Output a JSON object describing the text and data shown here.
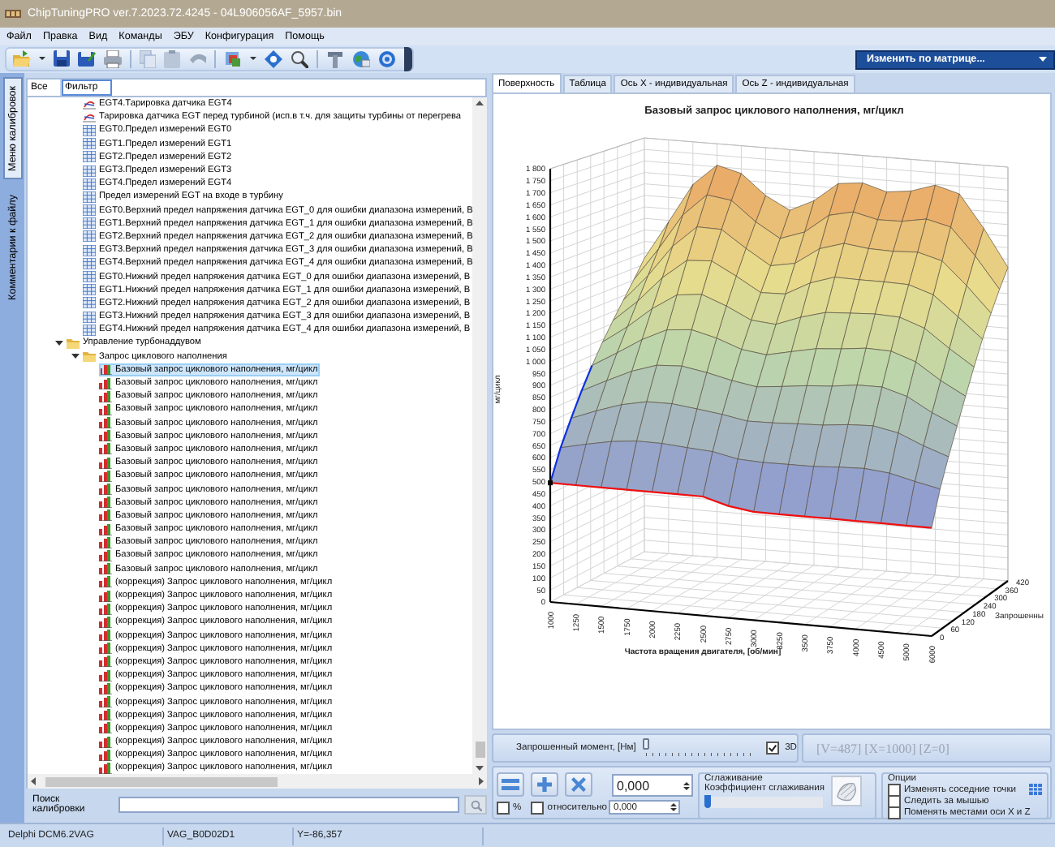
{
  "window": {
    "title": "ChipTuningPRO ver.7.2023.72.4245 - 04L906056AF_5957.bin"
  },
  "menu": [
    "Файл",
    "Правка",
    "Вид",
    "Команды",
    "ЭБУ",
    "Конфигурация",
    "Помощь"
  ],
  "matrix_dropdown": {
    "label": "Изменить по матрице..."
  },
  "side_tabs": [
    {
      "label": "Меню калибровок",
      "selected": true
    },
    {
      "label": "Комментарии к файлу",
      "selected": false
    }
  ],
  "tree": {
    "columns": [
      {
        "label": "Все",
        "selected": false
      },
      {
        "label": "Фильтр",
        "selected": true
      }
    ],
    "items": [
      {
        "children": [
          {
            "label": "EGT4.Тарировка датчика EGT4",
            "kind": "curve",
            "selected": false
          },
          {
            "label": "Тарировка датчика EGT перед турбиной (исп.в т.ч. для защиты турбины от перегрева",
            "kind": "curve",
            "selected": false
          },
          {
            "label": "EGT0.Предел измерений EGT0",
            "kind": "table",
            "selected": false
          },
          {
            "label": "EGT1.Предел измерений EGT1",
            "kind": "table",
            "selected": false
          },
          {
            "label": "EGT2.Предел измерений EGT2",
            "kind": "table",
            "selected": false
          },
          {
            "label": "EGT3.Предел измерений EGT3",
            "kind": "table",
            "selected": false
          },
          {
            "label": "EGT4.Предел измерений EGT4",
            "kind": "table",
            "selected": false
          },
          {
            "label": "Предел измерений EGT на входе в турбину",
            "kind": "table",
            "selected": false
          },
          {
            "label": "EGT0.Верхний предел напряжения датчика EGT_0 для ошибки диапазона измерений, В",
            "kind": "table",
            "selected": false
          },
          {
            "label": "EGT1.Верхний предел напряжения датчика EGT_1 для ошибки диапазона измерений, В",
            "kind": "table",
            "selected": false
          },
          {
            "label": "EGT2.Верхний предел напряжения датчика EGT_2 для ошибки диапазона измерений, В",
            "kind": "table",
            "selected": false
          },
          {
            "label": "EGT3.Верхний предел напряжения датчика EGT_3 для ошибки диапазона измерений, В",
            "kind": "table",
            "selected": false
          },
          {
            "label": "EGT4.Верхний предел напряжения датчика EGT_4 для ошибки диапазона измерений, В",
            "kind": "table",
            "selected": false
          },
          {
            "label": "EGT0.Нижний предел напряжения датчика EGT_0 для ошибки диапазона измерений, В",
            "kind": "table",
            "selected": false
          },
          {
            "label": "EGT1.Нижний предел напряжения датчика EGT_1 для ошибки диапазона измерений, В",
            "kind": "table",
            "selected": false
          },
          {
            "label": "EGT2.Нижний предел напряжения датчика EGT_2 для ошибки диапазона измерений, В",
            "kind": "table",
            "selected": false
          },
          {
            "label": "EGT3.Нижний предел напряжения датчика EGT_3 для ошибки диапазона измерений, В",
            "kind": "table",
            "selected": false
          },
          {
            "label": "EGT4.Нижний предел напряжения датчика EGT_4 для ошибки диапазона измерений, В",
            "kind": "table",
            "selected": false
          }
        ]
      },
      {
        "label": "Управление турбонаддувом",
        "kind": "folder",
        "expanded": true,
        "selected": false,
        "children": [
          {
            "label": "Запрос циклового наполнения",
            "kind": "folder",
            "expanded": true,
            "selected": false,
            "children": [
              {
                "label": "Базовый запрос циклового наполнения, мг/цикл",
                "kind": "map",
                "selected": true
              },
              {
                "label": "Базовый запрос циклового наполнения, мг/цикл",
                "kind": "map",
                "selected": false
              },
              {
                "label": "Базовый запрос циклового наполнения, мг/цикл",
                "kind": "map",
                "selected": false
              },
              {
                "label": "Базовый запрос циклового наполнения, мг/цикл",
                "kind": "map",
                "selected": false
              },
              {
                "label": "Базовый запрос циклового наполнения, мг/цикл",
                "kind": "map",
                "selected": false
              },
              {
                "label": "Базовый запрос циклового наполнения, мг/цикл",
                "kind": "map",
                "selected": false
              },
              {
                "label": "Базовый запрос циклового наполнения, мг/цикл",
                "kind": "map",
                "selected": false
              },
              {
                "label": "Базовый запрос циклового наполнения, мг/цикл",
                "kind": "map",
                "selected": false
              },
              {
                "label": "Базовый запрос циклового наполнения, мг/цикл",
                "kind": "map",
                "selected": false
              },
              {
                "label": "Базовый запрос циклового наполнения, мг/цикл",
                "kind": "map",
                "selected": false
              },
              {
                "label": "Базовый запрос циклового наполнения, мг/цикл",
                "kind": "map",
                "selected": false
              },
              {
                "label": "Базовый запрос циклового наполнения, мг/цикл",
                "kind": "map",
                "selected": false
              },
              {
                "label": "Базовый запрос циклового наполнения, мг/цикл",
                "kind": "map",
                "selected": false
              },
              {
                "label": "Базовый запрос циклового наполнения, мг/цикл",
                "kind": "map",
                "selected": false
              },
              {
                "label": "Базовый запрос циклового наполнения, мг/цикл",
                "kind": "map",
                "selected": false
              },
              {
                "label": "Базовый запрос циклового наполнения, мг/цикл",
                "kind": "map",
                "selected": false
              },
              {
                "label": "(коррекция) Запрос циклового наполнения, мг/цикл",
                "kind": "map",
                "selected": false
              },
              {
                "label": "(коррекция) Запрос циклового наполнения, мг/цикл",
                "kind": "map",
                "selected": false
              },
              {
                "label": "(коррекция) Запрос циклового наполнения, мг/цикл",
                "kind": "map",
                "selected": false
              },
              {
                "label": "(коррекция) Запрос циклового наполнения, мг/цикл",
                "kind": "map",
                "selected": false
              },
              {
                "label": "(коррекция) Запрос циклового наполнения, мг/цикл",
                "kind": "map",
                "selected": false
              },
              {
                "label": "(коррекция) Запрос циклового наполнения, мг/цикл",
                "kind": "map",
                "selected": false
              },
              {
                "label": "(коррекция) Запрос циклового наполнения, мг/цикл",
                "kind": "map",
                "selected": false
              },
              {
                "label": "(коррекция) Запрос циклового наполнения, мг/цикл",
                "kind": "map",
                "selected": false
              },
              {
                "label": "(коррекция) Запрос циклового наполнения, мг/цикл",
                "kind": "map",
                "selected": false
              },
              {
                "label": "(коррекция) Запрос циклового наполнения, мг/цикл",
                "kind": "map",
                "selected": false
              },
              {
                "label": "(коррекция) Запрос циклового наполнения, мг/цикл",
                "kind": "map",
                "selected": false
              },
              {
                "label": "(коррекция) Запрос циклового наполнения, мг/цикл",
                "kind": "map",
                "selected": false
              },
              {
                "label": "(коррекция) Запрос циклового наполнения, мг/цикл",
                "kind": "map",
                "selected": false
              },
              {
                "label": "(коррекция) Запрос циклового наполнения, мг/цикл",
                "kind": "map",
                "selected": false
              },
              {
                "label": "(коррекция) Запрос циклового наполнения, мг/цикл",
                "kind": "map",
                "selected": false
              }
            ]
          }
        ]
      }
    ]
  },
  "search": {
    "label": "Поиск калибровки"
  },
  "tabs": [
    {
      "label": "Поверхность",
      "selected": true
    },
    {
      "label": "Таблица",
      "selected": false
    },
    {
      "label": "Ось X - индивидуальная",
      "selected": false
    },
    {
      "label": "Ось Z - индивидуальная",
      "selected": false
    }
  ],
  "surface_chart": {
    "title": "Базовый запрос циклового наполнения, мг/цикл",
    "y_label": "мг/цикл",
    "x_label": "Частота вращения двигателя, [об/мин]",
    "z_label": "Запрошенны",
    "y_ticks": [
      "1 800",
      "1 750",
      "1 700",
      "1 650",
      "1 600",
      "1 550",
      "1 500",
      "1 450",
      "1 400",
      "1 350",
      "1 300",
      "1 250",
      "1 200",
      "1 150",
      "1 100",
      "1 050",
      "1 000",
      "950",
      "900",
      "850",
      "800",
      "750",
      "700",
      "650",
      "600",
      "550",
      "500",
      "450",
      "400",
      "350",
      "300",
      "250",
      "200",
      "150",
      "100",
      "50",
      "0"
    ],
    "x_ticks": [
      "1000",
      "1250",
      "1500",
      "1750",
      "2000",
      "2250",
      "2500",
      "2750",
      "3000",
      "3250",
      "3500",
      "3750",
      "4000",
      "4500",
      "5000",
      "6000"
    ],
    "z_ticks": [
      "0",
      "60",
      "120",
      "180",
      "240",
      "300",
      "360",
      "420"
    ]
  },
  "controls": {
    "torque": {
      "label": "Запрошенный момент, [Нм]",
      "level": 0
    },
    "view_3d": {
      "label": "3D",
      "checked": true
    },
    "readout": "[V=487] [X=1000] [Z=0]",
    "value": "0,000",
    "percent": {
      "label": "%",
      "checked": false
    },
    "relative": {
      "label": "относительно",
      "checked": false,
      "value": "0,000"
    },
    "smoothing": {
      "title": "Сглаживание",
      "label": "Коэффициент сглаживания",
      "level": 0
    },
    "options": {
      "title": "Опции",
      "items": [
        {
          "label": "Изменять соседние точки",
          "checked": false
        },
        {
          "label": "Следить за мышью",
          "checked": false
        },
        {
          "label": "Поменять местами оси X и Z",
          "checked": false
        }
      ]
    }
  },
  "status_bar": [
    "Delphi DCM6.2VAG",
    "VAG_B0D02D1",
    "Y=-86,357"
  ]
}
